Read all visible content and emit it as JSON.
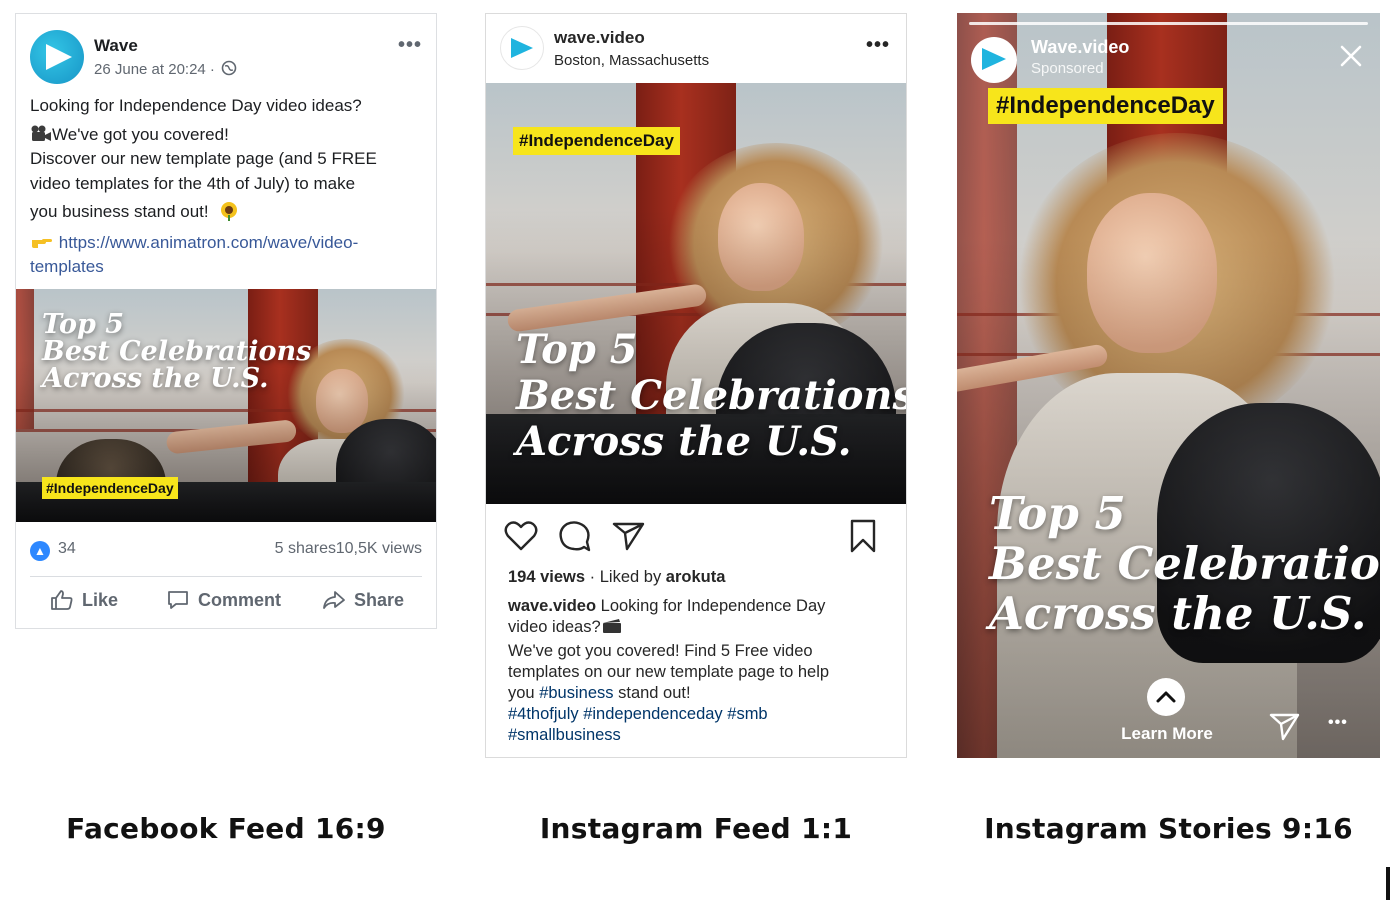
{
  "facebook": {
    "page_name": "Wave",
    "post_meta": "26 June at 20:24 ·",
    "post_lines": [
      "Looking for Independence Day video ideas?",
      "We've got you covered!",
      "Discover our new template page (and 5 FREE",
      "video templates for the 4th of July) to make",
      "you business stand out!"
    ],
    "link_line1": "https://www.animatron.com/wave/video-",
    "link_line2": "templates",
    "promo_lines": [
      "Top 5",
      "Best Celebrations",
      "Across the U.S."
    ],
    "hashtag": "#IndependenceDay",
    "reactions_count": "34",
    "shares": "5 shares",
    "views": "10,5K views",
    "actions": {
      "like": "Like",
      "comment": "Comment",
      "share": "Share"
    },
    "colors": {
      "link": "#385898",
      "like_badge": "#2d88ff"
    }
  },
  "instagram_feed": {
    "username": "wave.video",
    "location": "Boston, Massachusetts",
    "hashtag": "#IndependenceDay",
    "promo_lines": [
      "Top 5",
      "Best Celebrations",
      "Across the U.S."
    ],
    "views": "194 views",
    "liked_by": "· Liked by",
    "liked_by_user": "arokuta",
    "caption_user": "wave.video",
    "caption_line1": "Looking for Independence Day",
    "caption_line2": "video ideas?",
    "caption_line3": "We've got you covered! Find 5 Free video",
    "caption_line4": "templates on our new template page to help",
    "caption_line5_pre": "you",
    "caption_line5_tag": "#business",
    "caption_line5_post": "stand out!",
    "caption_tags1": "#4thofjuly #independenceday #smb",
    "caption_tags2": "#smallbusiness"
  },
  "instagram_story": {
    "username": "Wave.video",
    "sponsored": "Sponsored",
    "hashtag": "#IndependenceDay",
    "promo_lines": [
      "Top 5",
      "Best Celebrations",
      "Across the U.S."
    ],
    "cta": "Learn More"
  },
  "format_captions": {
    "facebook": "Facebook Feed 16:9",
    "instagram_feed": "Instagram Feed 1:1",
    "instagram_stories": "Instagram Stories 9:16"
  },
  "icons": [
    "wave-logo-icon",
    "more-dots-icon",
    "globe-icon",
    "film-icon",
    "sunflower-icon",
    "pointing-hand-icon",
    "thumbs-up-icon",
    "comment-icon",
    "share-arrow-icon",
    "heart-icon",
    "speech-bubble-icon",
    "paper-plane-icon",
    "bookmark-icon",
    "close-icon",
    "chevron-up-icon"
  ],
  "colors": {
    "hashtag_banner": "#f7e51b",
    "brand": "#1794c6"
  }
}
